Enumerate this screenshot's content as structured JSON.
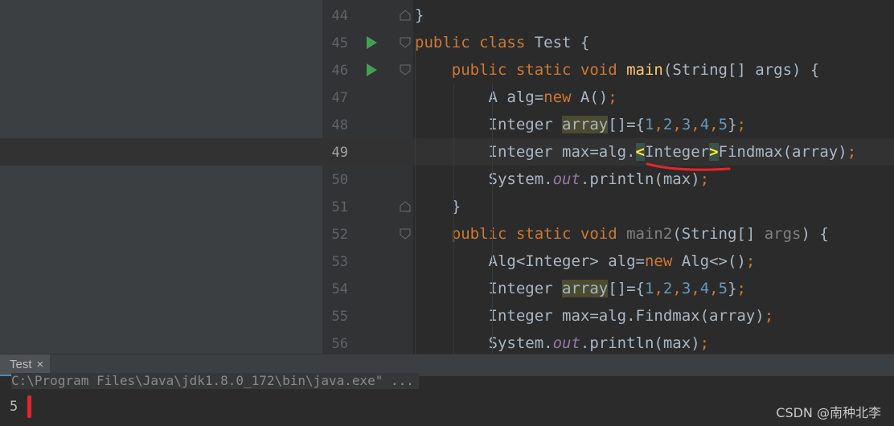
{
  "editor": {
    "lines": [
      {
        "num": "44",
        "segments": [
          {
            "t": "}",
            "c": ""
          }
        ]
      },
      {
        "num": "45",
        "run": true,
        "segments": [
          {
            "t": "public class ",
            "c": "kw"
          },
          {
            "t": "Test {",
            "c": ""
          }
        ]
      },
      {
        "num": "46",
        "run": true,
        "segments": [
          {
            "t": "    ",
            "c": ""
          },
          {
            "t": "public static void ",
            "c": "kw"
          },
          {
            "t": "main",
            "c": "fn"
          },
          {
            "t": "(String[] args) {",
            "c": ""
          }
        ]
      },
      {
        "num": "47",
        "segments": [
          {
            "t": "        A alg=",
            "c": ""
          },
          {
            "t": "new ",
            "c": "kw"
          },
          {
            "t": "A()",
            "c": ""
          },
          {
            "t": ";",
            "c": "kw"
          }
        ]
      },
      {
        "num": "48",
        "segments": [
          {
            "t": "        Integer ",
            "c": ""
          },
          {
            "t": "array",
            "c": "hl"
          },
          {
            "t": "[]={",
            "c": ""
          },
          {
            "t": "1",
            "c": "num"
          },
          {
            "t": ",",
            "c": "kw"
          },
          {
            "t": "2",
            "c": "num"
          },
          {
            "t": ",",
            "c": "kw"
          },
          {
            "t": "3",
            "c": "num"
          },
          {
            "t": ",",
            "c": "kw"
          },
          {
            "t": "4",
            "c": "num"
          },
          {
            "t": ",",
            "c": "kw"
          },
          {
            "t": "5",
            "c": "num"
          },
          {
            "t": "}",
            "c": ""
          },
          {
            "t": ";",
            "c": "kw"
          }
        ]
      },
      {
        "num": "49",
        "current": true,
        "segments": [
          {
            "t": "        Integer max=alg.",
            "c": ""
          },
          {
            "t": "<",
            "c": "br"
          },
          {
            "t": "Integer",
            "c": ""
          },
          {
            "t": ">",
            "c": "br"
          },
          {
            "t": "Findmax(array)",
            "c": ""
          },
          {
            "t": ";",
            "c": "kw"
          }
        ]
      },
      {
        "num": "50",
        "segments": [
          {
            "t": "        System.",
            "c": ""
          },
          {
            "t": "out",
            "c": "field"
          },
          {
            "t": ".println(max)",
            "c": ""
          },
          {
            "t": ";",
            "c": "kw"
          }
        ]
      },
      {
        "num": "51",
        "segments": [
          {
            "t": "    }",
            "c": ""
          }
        ]
      },
      {
        "num": "52",
        "segments": [
          {
            "t": "    ",
            "c": ""
          },
          {
            "t": "public static void ",
            "c": "kw"
          },
          {
            "t": "main2",
            "c": "dim"
          },
          {
            "t": "(String[] ",
            "c": ""
          },
          {
            "t": "args",
            "c": "dim"
          },
          {
            "t": ") {",
            "c": ""
          }
        ]
      },
      {
        "num": "53",
        "segments": [
          {
            "t": "        Alg<Integer> alg=",
            "c": ""
          },
          {
            "t": "new ",
            "c": "kw"
          },
          {
            "t": "Alg<>()",
            "c": ""
          },
          {
            "t": ";",
            "c": "kw"
          }
        ]
      },
      {
        "num": "54",
        "segments": [
          {
            "t": "        Integer ",
            "c": ""
          },
          {
            "t": "array",
            "c": "hl"
          },
          {
            "t": "[]={",
            "c": ""
          },
          {
            "t": "1",
            "c": "num"
          },
          {
            "t": ",",
            "c": "kw"
          },
          {
            "t": "2",
            "c": "num"
          },
          {
            "t": ",",
            "c": "kw"
          },
          {
            "t": "3",
            "c": "num"
          },
          {
            "t": ",",
            "c": "kw"
          },
          {
            "t": "4",
            "c": "num"
          },
          {
            "t": ",",
            "c": "kw"
          },
          {
            "t": "5",
            "c": "num"
          },
          {
            "t": "}",
            "c": ""
          },
          {
            "t": ";",
            "c": "kw"
          }
        ]
      },
      {
        "num": "55",
        "segments": [
          {
            "t": "        Integer max=alg.Findmax(array)",
            "c": ""
          },
          {
            "t": ";",
            "c": "kw"
          }
        ]
      },
      {
        "num": "56",
        "segments": [
          {
            "t": "        System.",
            "c": ""
          },
          {
            "t": "out",
            "c": "field"
          },
          {
            "t": ".println(max)",
            "c": ""
          },
          {
            "t": ";",
            "c": "kw"
          }
        ]
      }
    ]
  },
  "run_panel": {
    "tab_label": "Test",
    "close_glyph": "×",
    "command": "C:\\Program Files\\Java\\jdk1.8.0_172\\bin\\java.exe\" ...",
    "output": "5"
  },
  "watermark": "CSDN @南种北李",
  "colors": {
    "background": "#2b2b2b",
    "keyword": "#cc7832",
    "method": "#ffc66d",
    "number": "#6897bb",
    "run_icon": "#499c54",
    "annotation_red": "#e8242b"
  }
}
